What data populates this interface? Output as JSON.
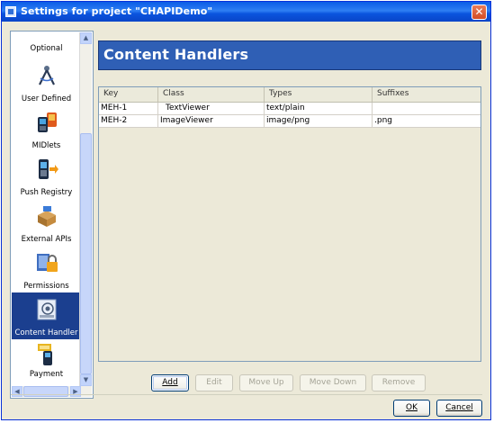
{
  "window": {
    "title": "Settings for project \"CHAPIDemo\"",
    "close_glyph": "✕"
  },
  "sidebar": {
    "items": [
      {
        "label": "Optional",
        "icon": "optional-icon"
      },
      {
        "label": "User Defined",
        "icon": "compass-icon"
      },
      {
        "label": "MIDlets",
        "icon": "midlets-phone-icon"
      },
      {
        "label": "Push Registry",
        "icon": "push-registry-icon"
      },
      {
        "label": "External APIs",
        "icon": "external-apis-icon"
      },
      {
        "label": "Permissions",
        "icon": "lock-icon"
      },
      {
        "label": "Content Handler",
        "icon": "content-handler-icon"
      },
      {
        "label": "Payment",
        "icon": "payment-icon"
      }
    ],
    "selected_index": 6,
    "scroll_up": "▲",
    "scroll_down": "▼",
    "scroll_left": "◀",
    "scroll_right": "▶"
  },
  "header": {
    "title": "Content Handlers"
  },
  "table": {
    "columns": [
      "Key",
      "Class",
      "Types",
      "Suffixes"
    ],
    "rows": [
      [
        "MEH-1",
        "TextViewer",
        "text/plain",
        ""
      ],
      [
        "MEH-2",
        "ImageViewer",
        "image/png",
        ".png"
      ]
    ]
  },
  "actions": {
    "add": "Add",
    "edit": "Edit",
    "move_up": "Move Up",
    "move_down": "Move Down",
    "remove": "Remove"
  },
  "footer": {
    "ok": "OK",
    "cancel": "Cancel"
  },
  "colors": {
    "title_bar": "#0a5ce6",
    "header_bg": "#2f5fb5",
    "selected_item": "#1b3f8f",
    "dialog_bg": "#ece9d8"
  }
}
